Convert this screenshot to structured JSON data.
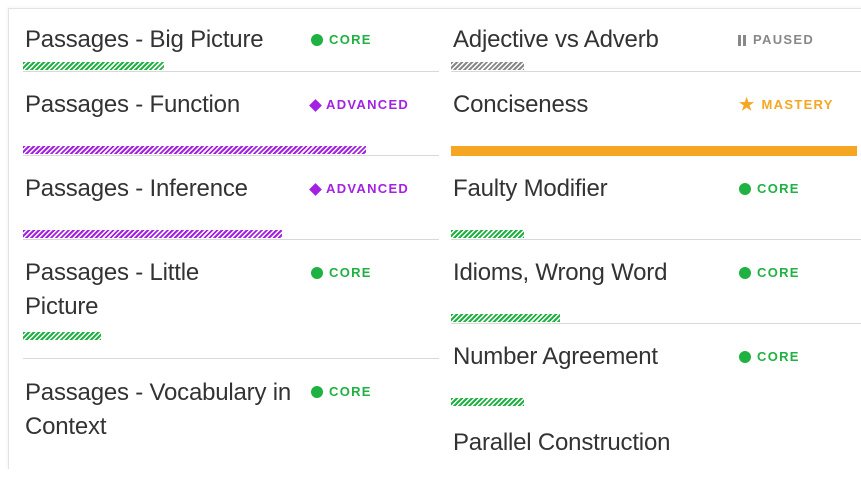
{
  "levels": {
    "core": {
      "label": "CORE",
      "icon": "filled-circle-icon",
      "color": "#1fb141"
    },
    "advanced": {
      "label": "ADVANCED",
      "icon": "diamond-icon",
      "color": "#a421e3"
    },
    "paused": {
      "label": "PAUSED",
      "icon": "pause-icon",
      "color": "#888888"
    },
    "mastery": {
      "label": "MASTERY",
      "icon": "star-icon",
      "color": "#f5a623"
    }
  },
  "left_column": [
    {
      "name": "Passages - Big Picture",
      "level": "CORE",
      "progress_percent": 37
    },
    {
      "name": "Passages - Function",
      "level": "ADVANCED",
      "progress_percent": 86
    },
    {
      "name": "Passages - Inference",
      "level": "ADVANCED",
      "progress_percent": 65
    },
    {
      "name": "Passages - Little Picture",
      "level": "CORE",
      "progress_percent": 19
    },
    {
      "name": "Passages - Vocabulary in Context",
      "level": "CORE",
      "progress_percent": null
    }
  ],
  "right_column": [
    {
      "name": "Adjective vs Adverb",
      "level": "PAUSED",
      "progress_percent": 18
    },
    {
      "name": "Conciseness",
      "level": "MASTERY",
      "progress_percent": 100
    },
    {
      "name": "Faulty Modifier",
      "level": "CORE",
      "progress_percent": 18
    },
    {
      "name": "Idioms, Wrong Word",
      "level": "CORE",
      "progress_percent": 27
    },
    {
      "name": "Number Agreement",
      "level": "CORE",
      "progress_percent": 18
    },
    {
      "name": "Parallel Construction",
      "level": "",
      "progress_percent": null
    }
  ]
}
